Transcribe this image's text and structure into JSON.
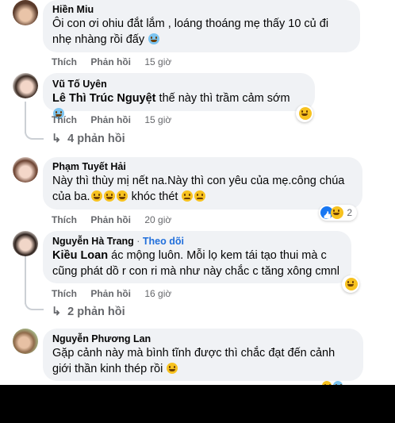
{
  "comments": [
    {
      "author": "Hiền Miu",
      "text_line1": "Ôi con ơi ohiu đắt lắm , loáng thoáng mẹ thấy 10 củ đi",
      "text_line2": "nhẹ nhàng rồi đấy",
      "like": "Thích",
      "reply": "Phản hồi",
      "time": "15 giờ"
    },
    {
      "author": "Vũ Tố Uyên",
      "mention": "Lê Thì Trúc Nguyệt",
      "text": "thế này thì trầm cảm sớm",
      "like": "Thích",
      "reply": "Phản hồi",
      "time": "15 giờ",
      "replies": "4 phản hồi"
    },
    {
      "author": "Phạm Tuyết Hải",
      "text_line1": "Này thì thùy mị nết na.Này thì con yêu của mẹ.công chúa",
      "text_line2a": "của ba.",
      "text_line2b": "khóc thét",
      "like": "Thích",
      "reply": "Phản hồi",
      "time": "20 giờ",
      "reaction_count": "2"
    },
    {
      "author": "Nguyễn Hà Trang",
      "follow_sep": " · ",
      "follow": "Theo dõi",
      "mention": "Kiều Loan",
      "text_line1": "ác mộng luôn. Mỗi lọ kem tái tạo thui mà c",
      "text_line2": "cũng phát dồ r con ri mà như này chắc c tăng xông cmnl",
      "like": "Thích",
      "reply": "Phản hồi",
      "time": "16 giờ",
      "replies": "2 phản hồi"
    },
    {
      "author": "Nguyễn Phương Lan",
      "text_line1": "Gặp cảnh này mà bình tĩnh được thì chắc đạt đến cảnh",
      "text_line2": "giới thần kinh thép rồi"
    }
  ],
  "icons": {
    "reply_arrow": "↳",
    "reaction_emoji": "laughing-emoji-icon",
    "like_reaction": "like-icon"
  },
  "colors": {
    "bubble": "#f0f2f5",
    "muted": "#65676b",
    "link": "#216fdb",
    "like_blue": "#1877f2"
  }
}
